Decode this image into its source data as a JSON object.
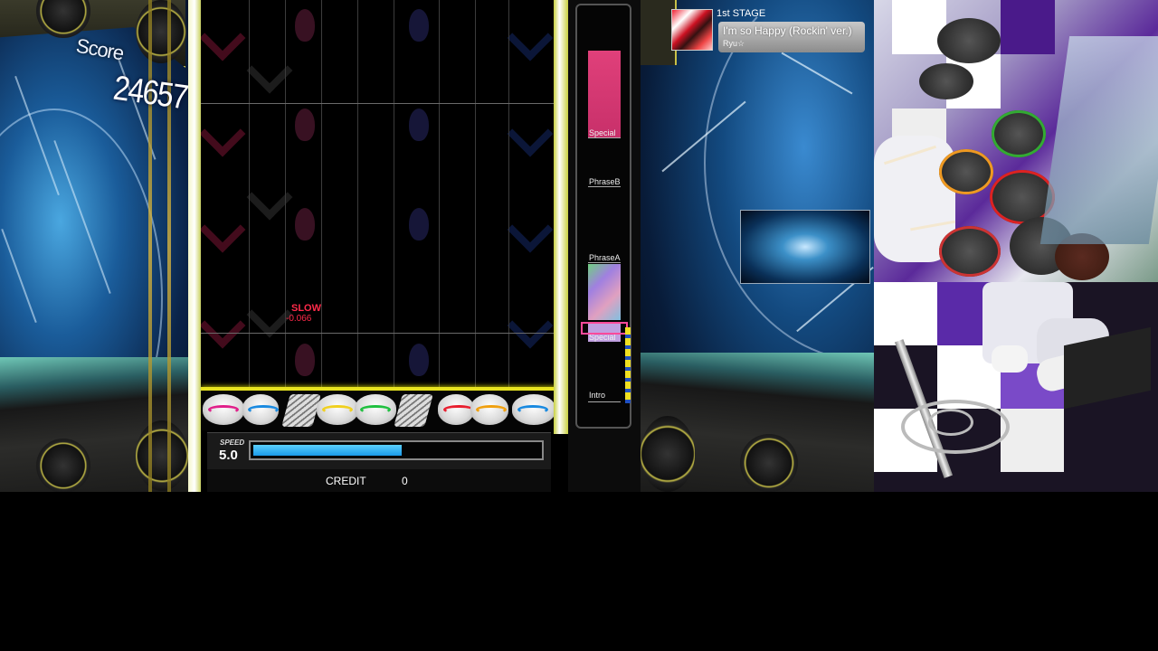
{
  "score": {
    "label": "Score",
    "value": "24657"
  },
  "judgement": {
    "timing_label": "SLOW",
    "offset": "-0.066"
  },
  "speed": {
    "label": "SPEED",
    "value": "5.0",
    "gauge_fraction": 0.52
  },
  "credit": {
    "label": "CREDIT",
    "value": "0"
  },
  "stage": {
    "label": "1st STAGE",
    "song_title": "I'm so Happy (Rockin' ver.)",
    "artist": "Ryu☆"
  },
  "phrases": [
    {
      "label": "Special",
      "color": "#e0407a"
    },
    {
      "label": "PhraseB",
      "color": "#1a1a1a"
    },
    {
      "label": "PhraseA",
      "color": "#9ad0a0"
    },
    {
      "label": "Special",
      "color": "#c0a0e0"
    },
    {
      "label": "Intro",
      "color": "#101010"
    }
  ],
  "colors": {
    "judge_line": "#e8e420",
    "speed_fill": "#1a9ae8",
    "slow_text": "#ff2a4a",
    "frame_gold": "#c8c048"
  },
  "pads": [
    {
      "name": "hihat-pad",
      "ring": "#e0208a"
    },
    {
      "name": "snare-pad",
      "ring": "#1a8ae0"
    },
    {
      "name": "high-tom-pad",
      "ring": "#f0d020"
    },
    {
      "name": "low-tom-pad",
      "ring": "#20c040"
    },
    {
      "name": "floor-tom-pad",
      "ring": "#e82030"
    },
    {
      "name": "cymbal-pad",
      "ring": "#f0a010"
    },
    {
      "name": "ride-pad",
      "ring": "#1a8ae0"
    }
  ]
}
